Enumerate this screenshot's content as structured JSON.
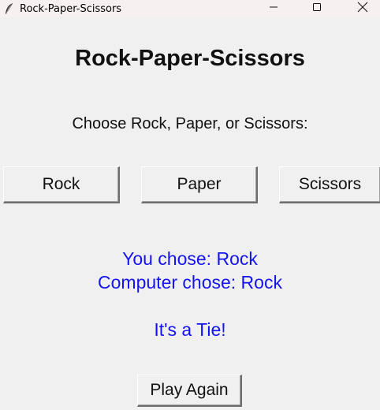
{
  "window": {
    "title": "Rock-Paper-Scissors",
    "app_icon": "feather-icon",
    "controls": [
      "minimize-icon",
      "maximize-icon",
      "close-icon"
    ]
  },
  "main": {
    "title": "Rock-Paper-Scissors",
    "prompt": "Choose Rock, Paper, or Scissors:",
    "choices": [
      {
        "label": "Rock"
      },
      {
        "label": "Paper"
      },
      {
        "label": "Scissors"
      }
    ],
    "result": {
      "user_choice": "You chose: Rock",
      "computer_choice": "Computer chose: Rock",
      "outcome": "It's a Tie!",
      "color": "#1414f0"
    },
    "play_again_label": "Play Again"
  }
}
